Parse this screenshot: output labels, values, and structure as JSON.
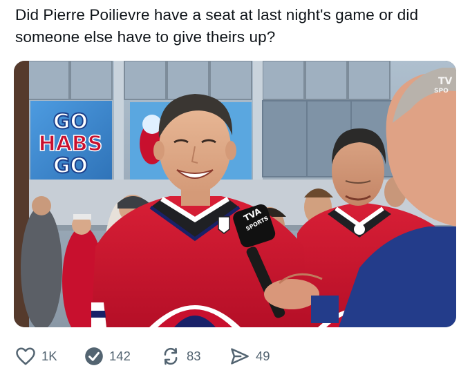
{
  "post": {
    "text": "Did Pierre Poilievre have a seat at last night's game or did someone else have to give theirs up?"
  },
  "media": {
    "sign_text": [
      "GO",
      "HABS",
      "GO"
    ],
    "mic_flag_text": [
      "TVA",
      "SPORTS"
    ],
    "broadcast_bug": [
      "TV",
      "SPO"
    ],
    "colors": {
      "jersey_red": "#c8102e",
      "jersey_blue": "#192168",
      "sky_blue": "#3d8ecb"
    }
  },
  "actions": {
    "like": {
      "icon": "heart-icon",
      "count": "1K"
    },
    "reply": {
      "icon": "check-badge-icon",
      "count": "142"
    },
    "repost": {
      "icon": "repost-icon",
      "count": "83"
    },
    "share": {
      "icon": "share-icon",
      "count": "49"
    }
  }
}
